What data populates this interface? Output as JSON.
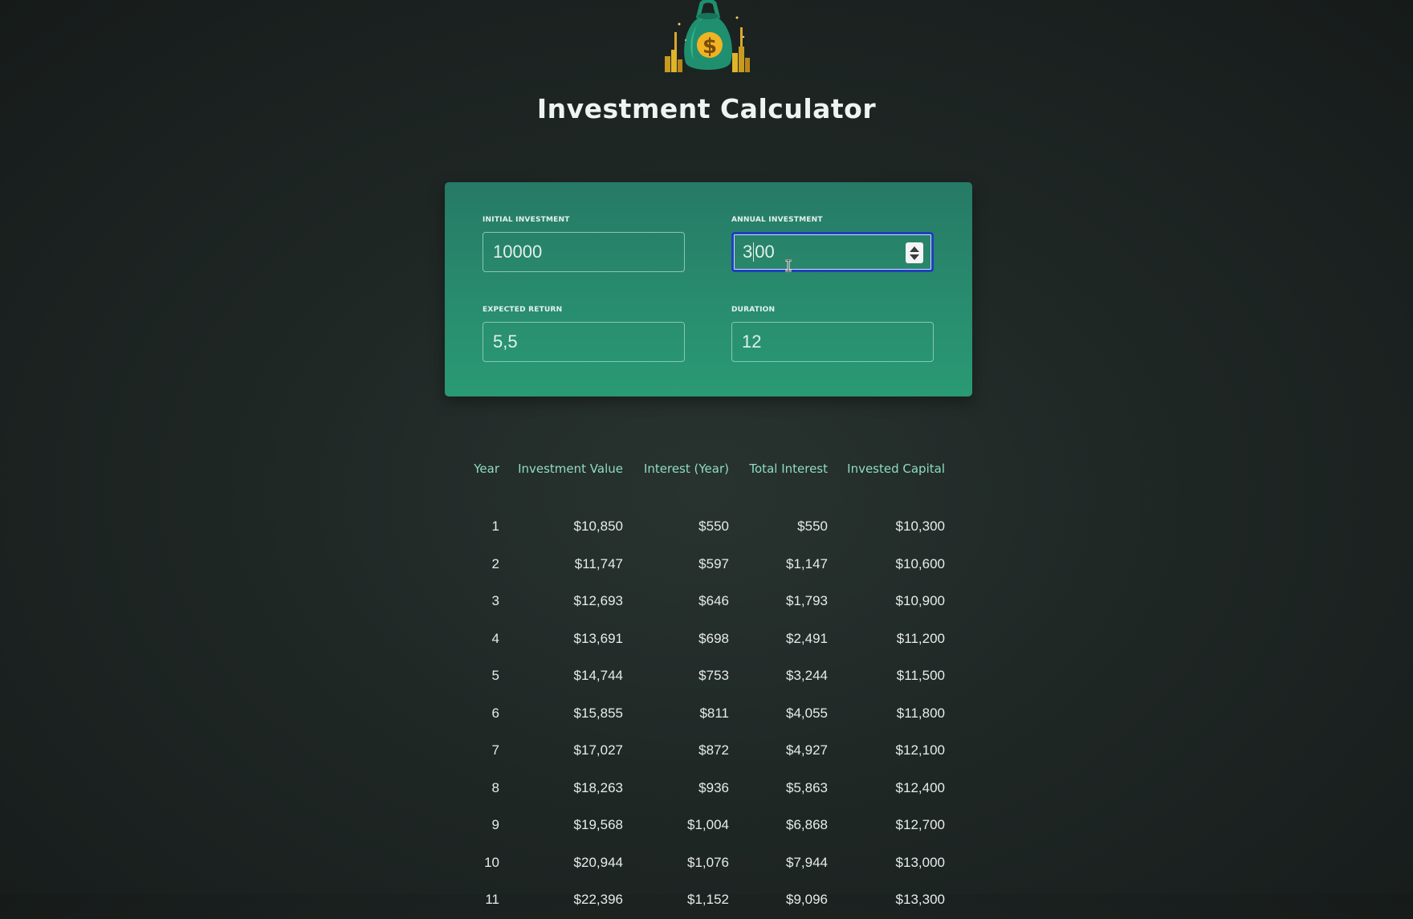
{
  "header": {
    "logo_icon": "money-bag-icon",
    "title": "Investment Calculator"
  },
  "inputs": {
    "initial_investment": {
      "label": "INITIAL INVESTMENT",
      "value": "10000"
    },
    "annual_investment": {
      "label": "ANNUAL INVESTMENT",
      "value_before_caret": "3",
      "value_after_caret": "00",
      "focused": true
    },
    "expected_return": {
      "label": "EXPECTED RETURN",
      "value": "5,5"
    },
    "duration": {
      "label": "DURATION",
      "value": "12"
    }
  },
  "colors": {
    "accent": "#8fdcc3",
    "panel_top": "#267a66",
    "panel_bottom": "#2a9a74",
    "focus_ring": "#1f3fbf"
  },
  "table": {
    "columns": [
      "Year",
      "Investment Value",
      "Interest (Year)",
      "Total Interest",
      "Invested Capital"
    ],
    "rows": [
      [
        "1",
        "$10,850",
        "$550",
        "$550",
        "$10,300"
      ],
      [
        "2",
        "$11,747",
        "$597",
        "$1,147",
        "$10,600"
      ],
      [
        "3",
        "$12,693",
        "$646",
        "$1,793",
        "$10,900"
      ],
      [
        "4",
        "$13,691",
        "$698",
        "$2,491",
        "$11,200"
      ],
      [
        "5",
        "$14,744",
        "$753",
        "$3,244",
        "$11,500"
      ],
      [
        "6",
        "$15,855",
        "$811",
        "$4,055",
        "$11,800"
      ],
      [
        "7",
        "$17,027",
        "$872",
        "$4,927",
        "$12,100"
      ],
      [
        "8",
        "$18,263",
        "$936",
        "$5,863",
        "$12,400"
      ],
      [
        "9",
        "$19,568",
        "$1,004",
        "$6,868",
        "$12,700"
      ],
      [
        "10",
        "$20,944",
        "$1,076",
        "$7,944",
        "$13,000"
      ],
      [
        "11",
        "$22,396",
        "$1,152",
        "$9,096",
        "$13,300"
      ]
    ]
  }
}
